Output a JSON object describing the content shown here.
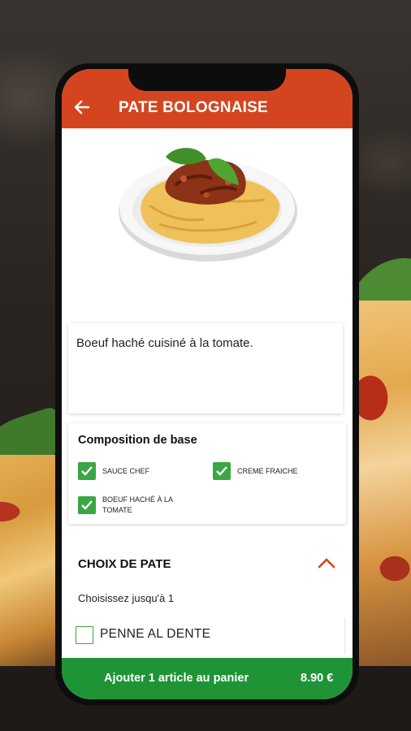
{
  "header": {
    "title": "PATE BOLOGNAISE"
  },
  "description": "Boeuf haché cuisiné à la tomate.",
  "composition": {
    "title": "Composition de base",
    "items": [
      {
        "label": "SAUCE CHEF",
        "checked": true
      },
      {
        "label": "CREME FRAICHE",
        "checked": true
      },
      {
        "label": "BOEUF HACHÉ À LA TOMATE",
        "checked": true
      }
    ]
  },
  "pasta_choice": {
    "title": "CHOIX DE PATE",
    "subtitle": "Choisissez jusqu'à 1",
    "options": [
      {
        "label": "PENNE AL DENTE",
        "checked": false
      }
    ]
  },
  "cart": {
    "label": "Ajouter 1 article au panier",
    "price": "8.90 €"
  },
  "colors": {
    "header": "#d4451f",
    "accent_green": "#3aa645",
    "cart_bar": "#1e9436"
  }
}
